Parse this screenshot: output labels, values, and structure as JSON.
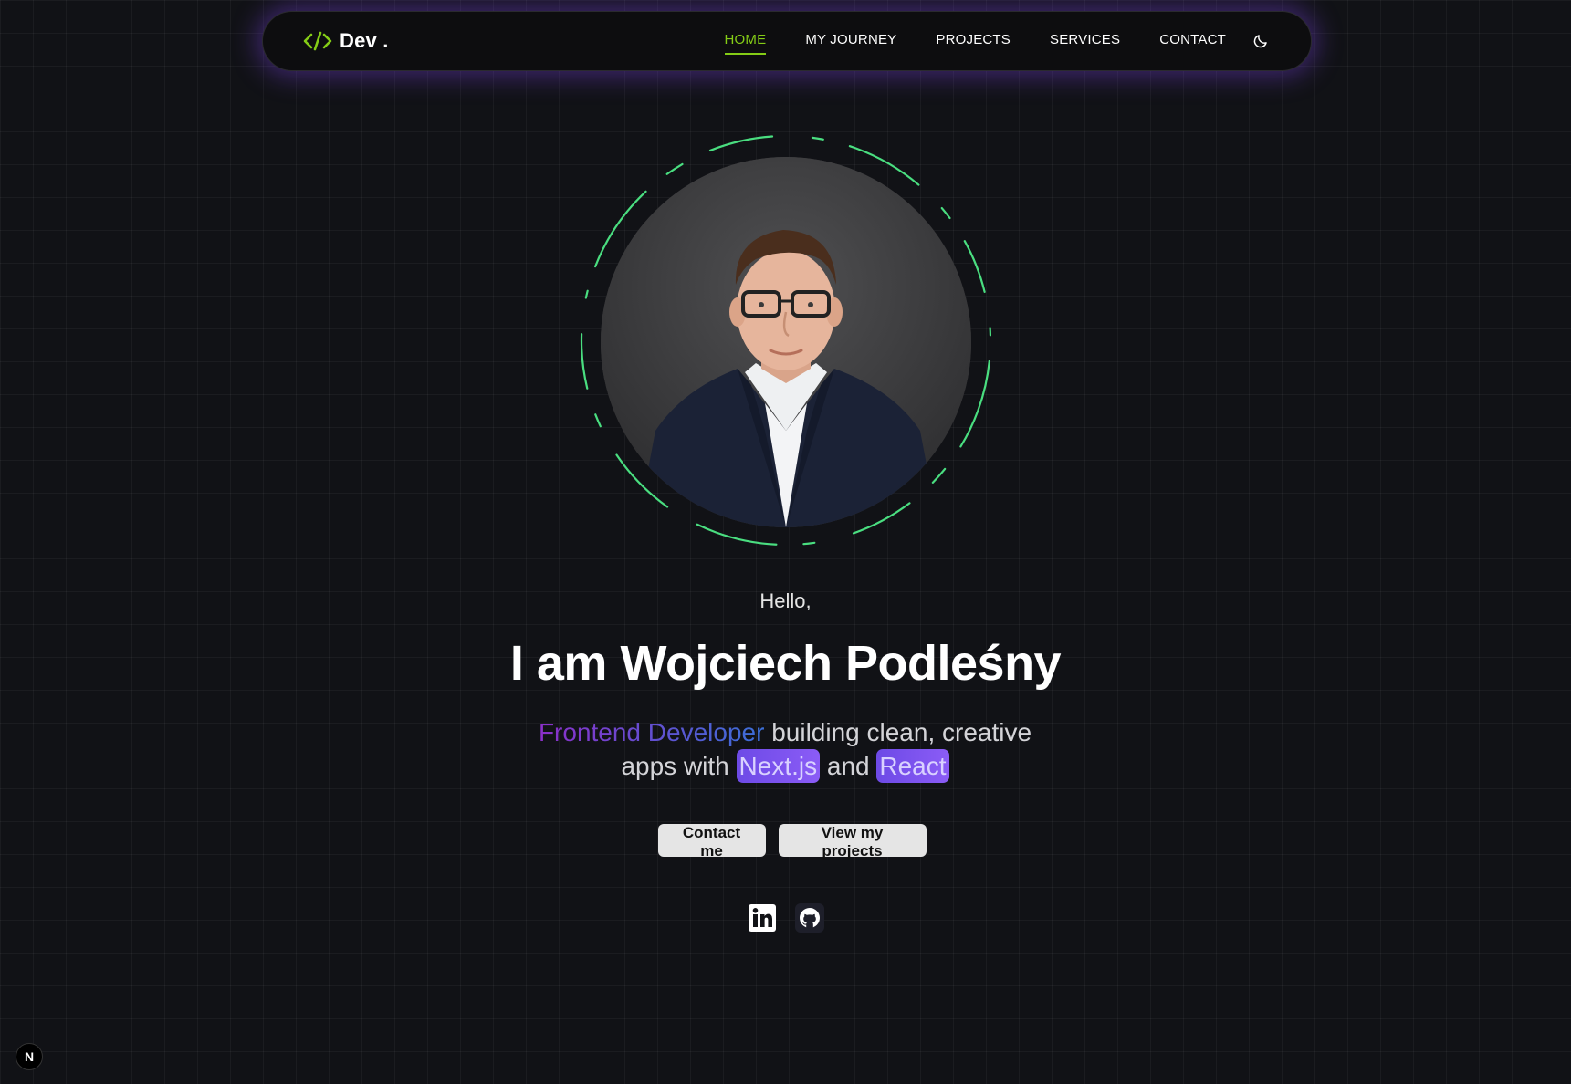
{
  "nav": {
    "brand": "Dev .",
    "links": [
      "HOME",
      "MY JOURNEY",
      "PROJECTS",
      "SERVICES",
      "CONTACT"
    ],
    "active": "HOME",
    "theme_icon": "moon-icon"
  },
  "hero": {
    "greeting": "Hello,",
    "headline": "I am Wojciech Podleśny",
    "role": "Frontend Developer",
    "tagline_mid": " building clean, creative apps with ",
    "tech1": "Next.js",
    "and": " and ",
    "tech2": "React",
    "buttons": {
      "contact": "Contact me",
      "projects": "View my projects"
    },
    "socials": [
      "linkedin-icon",
      "github-icon"
    ]
  },
  "badge": {
    "label": "N"
  },
  "colors": {
    "accent": "#84cc16",
    "ring": "#4ade80",
    "glow": "#7640dc",
    "chip": "#7c4dff",
    "background": "#111216"
  }
}
